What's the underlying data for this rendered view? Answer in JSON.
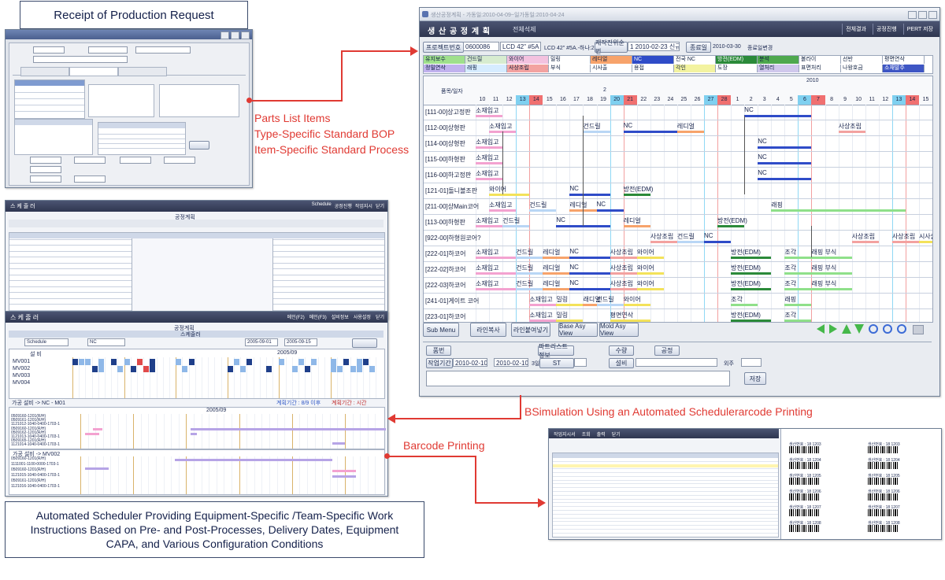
{
  "callouts": {
    "production_request": "Receipt of Production Request",
    "parts_list": [
      "Parts List Items",
      "Type-Specific Standard BOP",
      "Item-Specific Standard Process"
    ],
    "simulation": "BSimulation Using an Automated Schedulerarcode Printing",
    "barcode": "Barcode Printing",
    "scheduler_desc": "Automated Scheduler Providing Equipment-Specific /Team-Specific Work Instructions Based on Pre- and Post-Processes, Delivery Dates, Equipment CAPA, and Various Configuration Conditions"
  },
  "plan_window": {
    "title": "생산공정계획 - 가동일:2010-04-09~일가동일:2010-04-24",
    "header_title": "생 산 공 정 계 획",
    "header_sub": "전체석제",
    "header_buttons": [
      "전체결과",
      "공정진행",
      "PERT 저장"
    ],
    "project_label": "프로젝트번호",
    "project_value": "0600086",
    "model_value": "LCD 42\" #5A",
    "model_text": "LCD 42\" #5A.-하나:2",
    "date_btn": "제작진위순번",
    "date_value": "1 2010-02-23 신규",
    "end_btn": "종료일",
    "end_value": "2010-03-30",
    "end_change": "종료일변경",
    "legend_row1": [
      {
        "t": "유지보수",
        "c": "#9fe08c"
      },
      {
        "t": "건드릴",
        "c": "#d7ecd0"
      },
      {
        "t": "와이어",
        "c": "#f3c2df"
      },
      {
        "t": "밀링",
        "c": "#ffffff"
      },
      {
        "t": "레디얼",
        "c": "#f7a36b"
      },
      {
        "t": "NC",
        "c": "#2f4cc8"
      },
      {
        "t": "전국 NC",
        "c": "#ffffff"
      },
      {
        "t": "방전(EDM)",
        "c": "#2b8a3a"
      },
      {
        "t": "분석",
        "c": "#4ea84e"
      },
      {
        "t": "볼라이",
        "c": "#ffffff"
      },
      {
        "t": "선반",
        "c": "#ffffff"
      },
      {
        "t": "평면연삭",
        "c": "#ffffff"
      }
    ],
    "legend_row2": [
      {
        "t": "정밀연삭",
        "c": "#c1b2ee"
      },
      {
        "t": "래핑",
        "c": "#d6ecff"
      },
      {
        "t": "사상조립",
        "c": "#f3a2a0"
      },
      {
        "t": "부식",
        "c": "#ffffff"
      },
      {
        "t": "시사출",
        "c": "#ffffff"
      },
      {
        "t": "용접",
        "c": "#ffffff"
      },
      {
        "t": "각인",
        "c": "#f3f3a0"
      },
      {
        "t": "도장",
        "c": "#ffffff"
      },
      {
        "t": "열처리",
        "c": "#d0c8ec"
      },
      {
        "t": "표면처리",
        "c": "#ffffff"
      },
      {
        "t": "나왕호금",
        "c": "#ffffff"
      },
      {
        "t": "소재발주",
        "c": "#3e56c4"
      }
    ],
    "col_header": "품목/일자",
    "year": "2010",
    "month_feb": "2",
    "days": [
      "10",
      "11",
      "12",
      "13",
      "14",
      "15",
      "16",
      "17",
      "18",
      "19",
      "20",
      "21",
      "22",
      "23",
      "24",
      "25",
      "26",
      "27",
      "28",
      "1",
      "2",
      "3",
      "4",
      "5",
      "6",
      "7",
      "8",
      "9",
      "10",
      "11",
      "12",
      "13",
      "14",
      "15"
    ],
    "rows": [
      "[111-00]상고정판",
      "[112-00]상형판",
      "[114-00]상형판",
      "[115-00]하형판",
      "[116-00]하고정판",
      "[121-01]돌니볼조판",
      "[211-00]상Main코어",
      "[113-00]하형판",
      "[922-00]하형원코어?",
      "[222-01]하코어",
      "[222-02]하코어",
      "[222-03]하코어",
      "[241-01]게이트 코어",
      "[223-01]하코어"
    ],
    "task_labels": [
      "소재입고",
      "NC",
      "소재입고",
      "건드릴",
      "NC",
      "레디얼",
      "사상조립",
      "소재입고",
      "NC",
      "소재입고",
      "NC",
      "소재입고",
      "NC",
      "와이어",
      "NC",
      "방전(EDM)",
      "소재입고",
      "건드릴",
      "레디얼",
      "NC",
      "래핑",
      "소재입고",
      "건드릴",
      "NC",
      "레디얼",
      "방전(EDM)",
      "사상조립",
      "건드릴",
      "NC",
      "사상조립",
      "사상조립",
      "시사출",
      "소재입고",
      "건드릴",
      "레디얼",
      "NC",
      "사상조립",
      "와이어",
      "방전(EDM)",
      "조각",
      "래핑",
      "부식",
      "소재입고",
      "건드릴",
      "레디얼",
      "NC",
      "사상조립",
      "와이어",
      "방전(EDM)",
      "조각",
      "래핑",
      "부식",
      "소재입고",
      "건드릴",
      "레디얼",
      "NC",
      "사상조립",
      "와이어",
      "방전(EDM)",
      "조각",
      "래핑",
      "부식",
      "소재입고",
      "밀링",
      "래디얼",
      "건드릴",
      "와이어",
      "조각",
      "래핑",
      "소재입고",
      "밀링",
      "평면연삭",
      "방전(EDM)",
      "조각"
    ],
    "bottom_buttons": [
      "Sub Menu",
      "라인복사",
      "라인붙여넣기",
      "Base Asy View",
      "Mold Asy View"
    ],
    "form": {
      "button_label": "품번",
      "part_btn": "파트리스트정보",
      "qty_btn": "수량",
      "process_btn": "공정",
      "work_period": "작업기간",
      "from_date": "2010-02-10",
      "to_date": "2010-02-10",
      "days": "3일",
      "st": "ST",
      "equipment": "설비",
      "outsource": "외주",
      "save": "저장"
    }
  },
  "request_window": {
    "rows": [
      "회원번호",
      "고객번호",
      "품명",
      "코드",
      "정보"
    ],
    "buttons": [
      "저장",
      "취소"
    ]
  },
  "scheduler_window": {
    "title": "스 케 줄 러",
    "header_buttons": [
      "메인(F2)",
      "메인(F3)",
      "설비정보",
      "사용설정",
      "닫기"
    ],
    "section_title": "공정계획",
    "table_title": "스케줄러",
    "filter": "Schedule",
    "filter2": "NC",
    "range_from": "2005-09-01",
    "range_to": "2005-09-15",
    "col1": "설 비",
    "month": "2005/09",
    "machines": [
      "MV001",
      "MV002",
      "MV003",
      "MV004"
    ],
    "lower_label": "가공 설비 -> NC - M01",
    "lower_legend_a": "계획기간 : 8/9 이후",
    "lower_legend_b": "계획기간 : 시간",
    "month2": "2005/09",
    "tasks": [
      "0509160-1201(R/H)",
      "0509161-1201(R/H)",
      "1121012-1040-0400-1703-1",
      "0509160-1201(R/H)",
      "0509162-1201(R/H)",
      "1121013-1040-0400-1703-1",
      "0509165-1201(R/H)",
      "1121014-1040-0400-1703-1"
    ],
    "lower2_label": "가공 설비 -> MV002",
    "tasks2": [
      "0509160-1201(R/H)",
      "1111001-1100-0000-1703-1",
      "0509160-1201(R/H)",
      "1121015-1040-0400-1703-1",
      "0509161-1201(R/H)",
      "1121016-1040-0400-1703-1"
    ]
  },
  "list_window": {
    "title": "스 케 줄 러",
    "section": "공정계획",
    "header_buttons": [
      "Schedule",
      "공정진행",
      "작업지시",
      "닫기"
    ]
  },
  "barcode_window": {
    "tabs": [
      "작업지시서",
      "조회",
      "출력",
      "닫기"
    ],
    "labels": [
      "생산번호 : 18 1203",
      "생산번호 : 18 1204",
      "생산번호 : 18 1205",
      "생산번호 : 18 1206",
      "생산번호 : 18 1207",
      "생산번호 : 18 1208"
    ]
  }
}
